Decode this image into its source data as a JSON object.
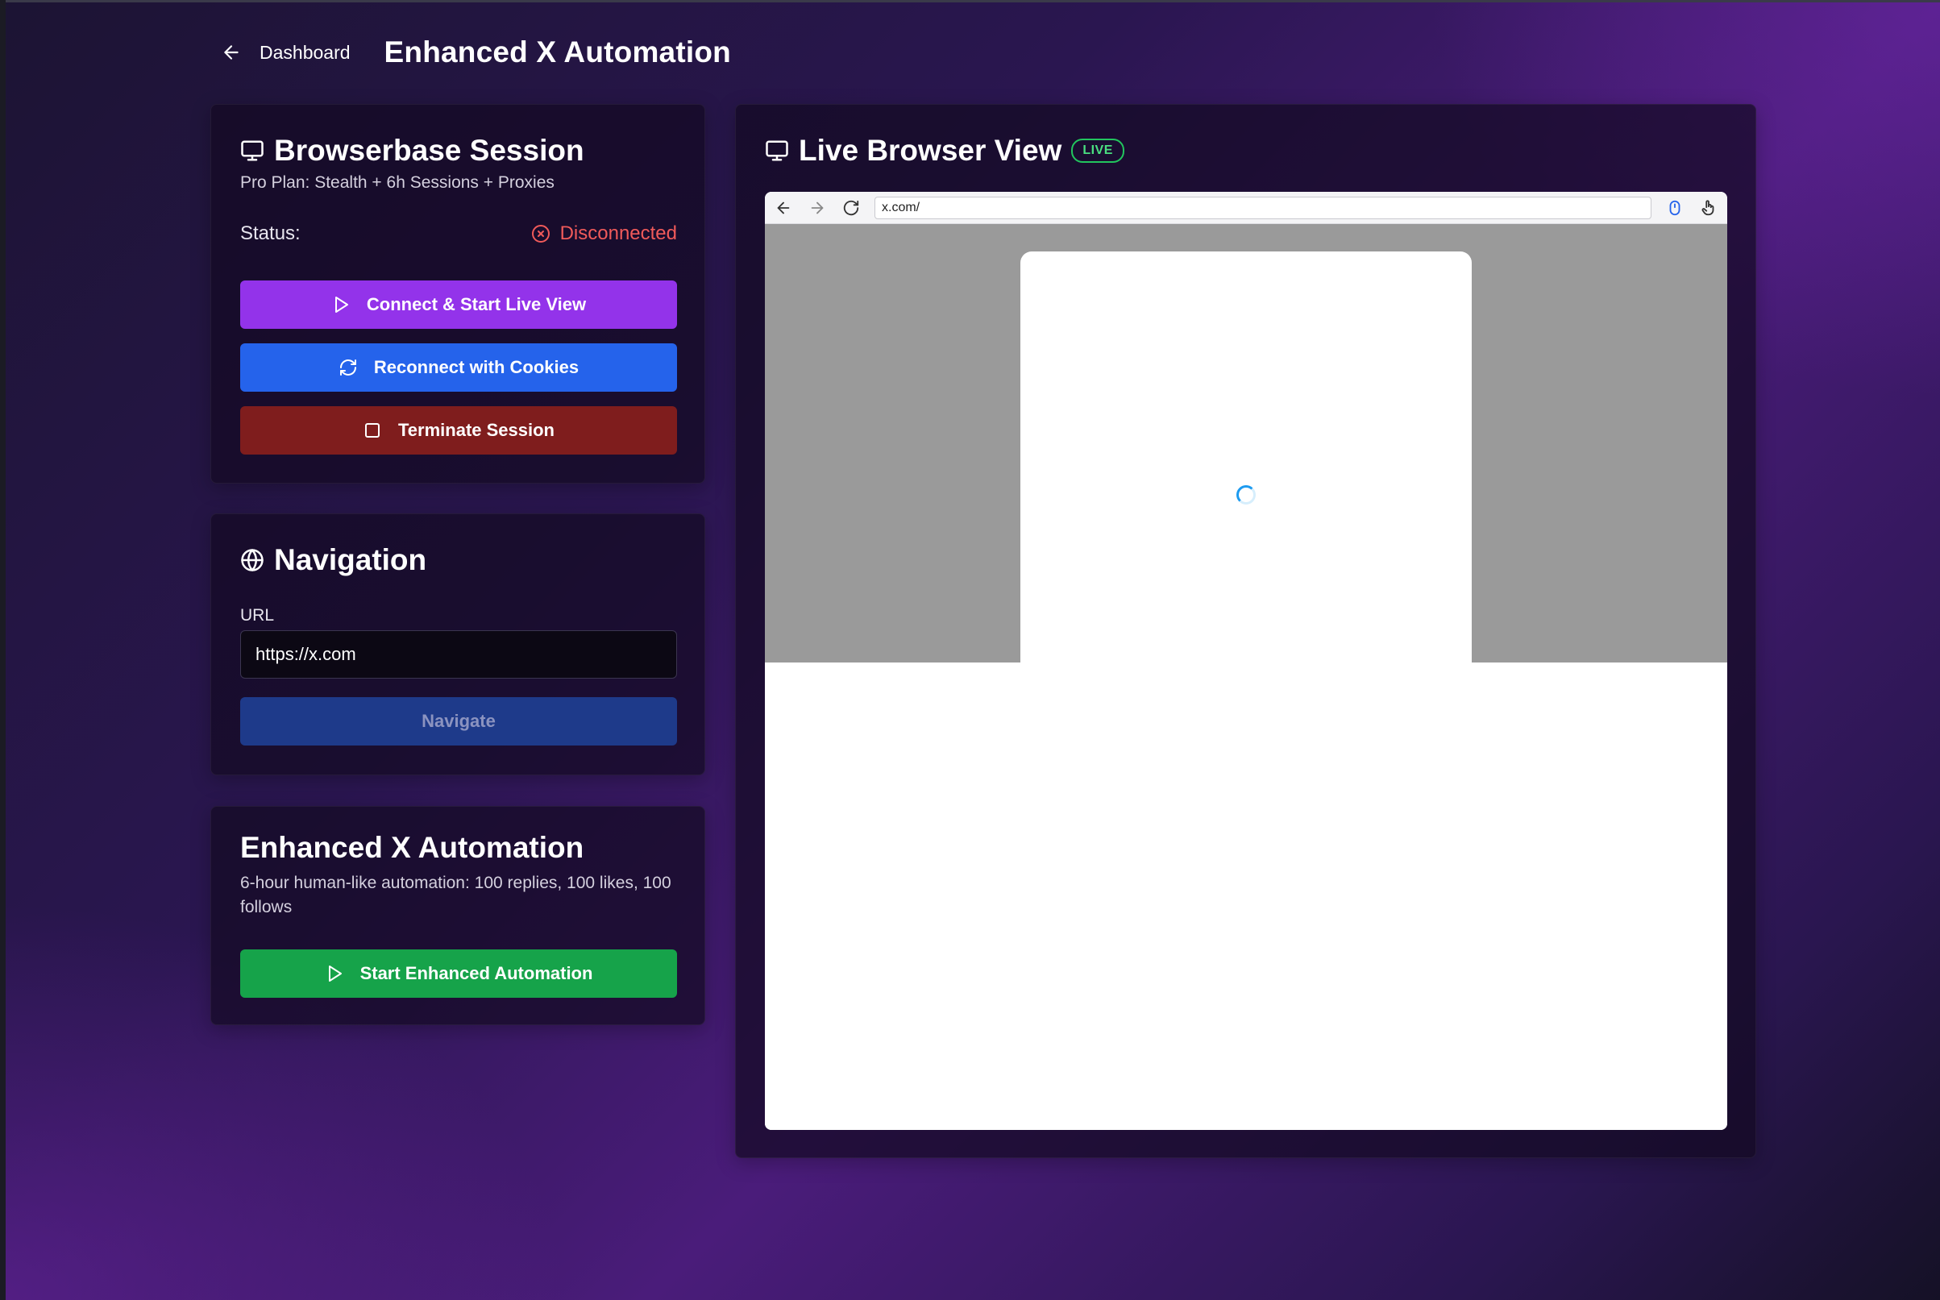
{
  "header": {
    "back_label": "Dashboard",
    "title": "Enhanced X Automation"
  },
  "session": {
    "title": "Browserbase Session",
    "subtitle": "Pro Plan: Stealth + 6h Sessions + Proxies",
    "status_label": "Status:",
    "status_value": "Disconnected",
    "status_color": "#f05a5a",
    "connect_label": "Connect & Start Live View",
    "reconnect_label": "Reconnect with Cookies",
    "terminate_label": "Terminate Session"
  },
  "navigation": {
    "title": "Navigation",
    "url_label": "URL",
    "url_value": "https://x.com",
    "navigate_label": "Navigate"
  },
  "automation": {
    "title": "Enhanced X Automation",
    "description": "6-hour human-like automation: 100 replies, 100 likes, 100 follows",
    "start_label": "Start Enhanced Automation"
  },
  "live_view": {
    "title": "Live Browser View",
    "badge": "LIVE",
    "address": "x.com/"
  },
  "colors": {
    "purple_button": "#9333ea",
    "blue_button": "#2563eb",
    "red_button": "#7f1d1d",
    "navy_button": "#1e3a8a",
    "green_button": "#16a34a",
    "live_green": "#22c55e"
  },
  "icons": {
    "back": "arrow-left-icon",
    "monitor": "monitor-icon",
    "status": "x-circle-icon",
    "play": "play-icon",
    "refresh": "refresh-icon",
    "stop": "square-icon",
    "globe": "globe-icon",
    "mouse": "mouse-icon",
    "pointer": "pointer-hand-icon"
  }
}
